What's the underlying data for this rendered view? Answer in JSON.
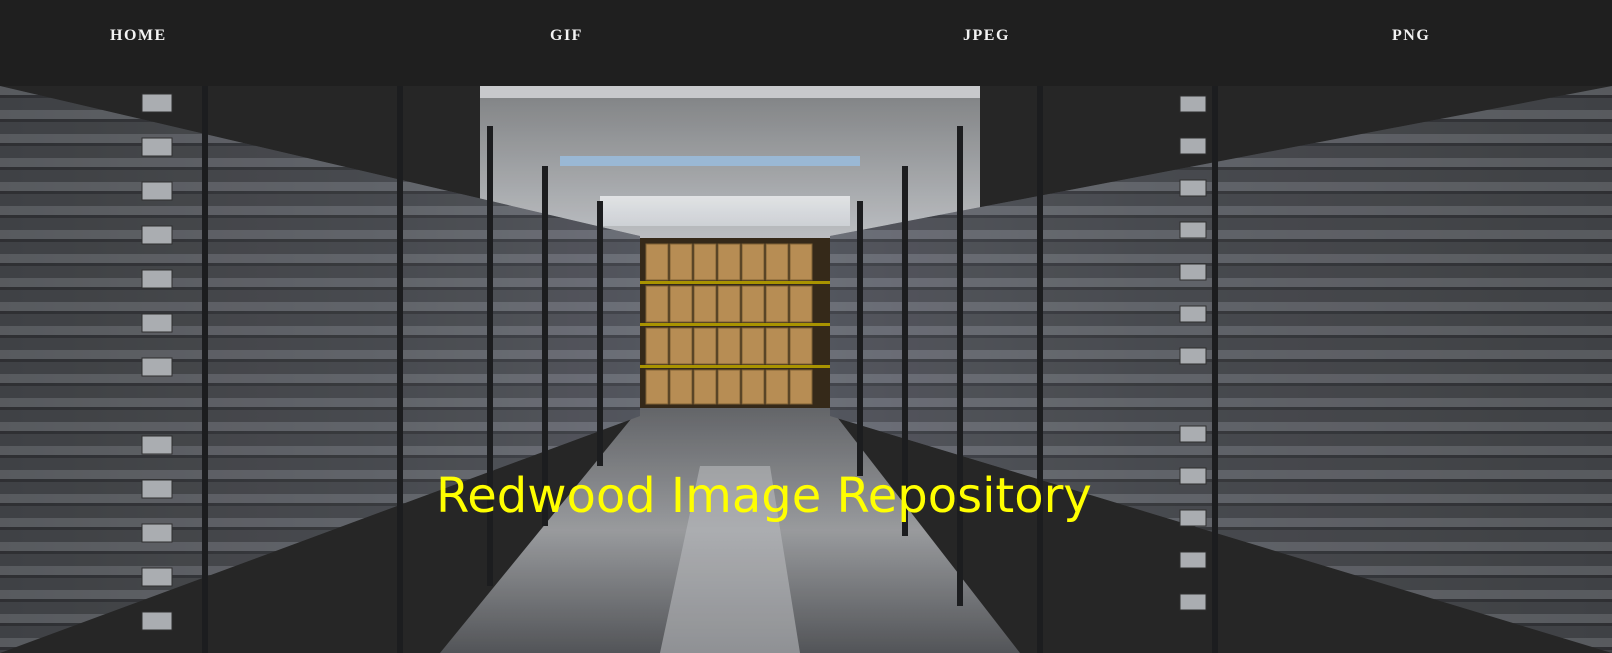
{
  "nav": {
    "items": [
      {
        "label": "HOME"
      },
      {
        "label": "GIF"
      },
      {
        "label": "JPEG"
      },
      {
        "label": "PNG"
      }
    ]
  },
  "hero": {
    "title": "Redwood Image Repository",
    "title_color": "#ffff00",
    "image_description_icon": "archive-aisle-photo"
  }
}
